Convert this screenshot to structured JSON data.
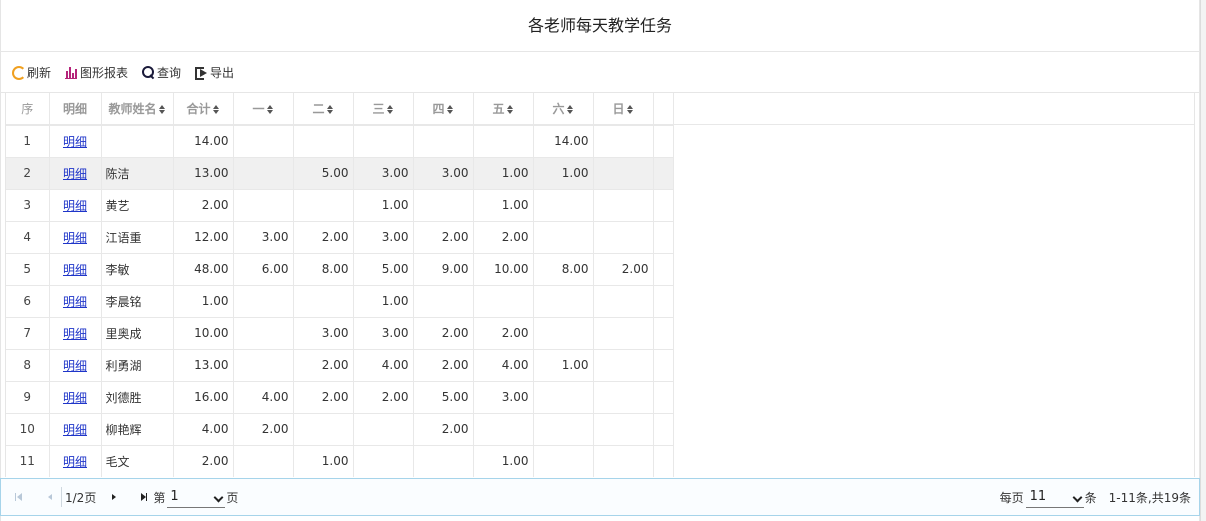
{
  "title": "各老师每天教学任务",
  "toolbar": {
    "refresh": "刷新",
    "chart_report": "图形报表",
    "query": "查询",
    "export": "导出"
  },
  "grid": {
    "headers": {
      "seq": "序",
      "detail": "明细",
      "name": "教师姓名",
      "total": "合计",
      "mon": "一",
      "tue": "二",
      "wed": "三",
      "thu": "四",
      "fri": "五",
      "sat": "六",
      "sun": "日"
    },
    "rows": [
      {
        "seq": "1",
        "detail": "明细",
        "name": "",
        "total": "14.00",
        "mon": "",
        "tue": "",
        "wed": "",
        "thu": "",
        "fri": "",
        "sat": "14.00",
        "sun": ""
      },
      {
        "seq": "2",
        "detail": "明细",
        "name": "陈洁",
        "total": "13.00",
        "mon": "",
        "tue": "5.00",
        "wed": "3.00",
        "thu": "3.00",
        "fri": "1.00",
        "sat": "1.00",
        "sun": ""
      },
      {
        "seq": "3",
        "detail": "明细",
        "name": "黄艺",
        "total": "2.00",
        "mon": "",
        "tue": "",
        "wed": "1.00",
        "thu": "",
        "fri": "1.00",
        "sat": "",
        "sun": ""
      },
      {
        "seq": "4",
        "detail": "明细",
        "name": "江语重",
        "total": "12.00",
        "mon": "3.00",
        "tue": "2.00",
        "wed": "3.00",
        "thu": "2.00",
        "fri": "2.00",
        "sat": "",
        "sun": ""
      },
      {
        "seq": "5",
        "detail": "明细",
        "name": "李敏",
        "total": "48.00",
        "mon": "6.00",
        "tue": "8.00",
        "wed": "5.00",
        "thu": "9.00",
        "fri": "10.00",
        "sat": "8.00",
        "sun": "2.00"
      },
      {
        "seq": "6",
        "detail": "明细",
        "name": "李晨铭",
        "total": "1.00",
        "mon": "",
        "tue": "",
        "wed": "1.00",
        "thu": "",
        "fri": "",
        "sat": "",
        "sun": ""
      },
      {
        "seq": "7",
        "detail": "明细",
        "name": "里奥成",
        "total": "10.00",
        "mon": "",
        "tue": "3.00",
        "wed": "3.00",
        "thu": "2.00",
        "fri": "2.00",
        "sat": "",
        "sun": ""
      },
      {
        "seq": "8",
        "detail": "明细",
        "name": "利勇湖",
        "total": "13.00",
        "mon": "",
        "tue": "2.00",
        "wed": "4.00",
        "thu": "2.00",
        "fri": "4.00",
        "sat": "1.00",
        "sun": ""
      },
      {
        "seq": "9",
        "detail": "明细",
        "name": "刘德胜",
        "total": "16.00",
        "mon": "4.00",
        "tue": "2.00",
        "wed": "2.00",
        "thu": "5.00",
        "fri": "3.00",
        "sat": "",
        "sun": ""
      },
      {
        "seq": "10",
        "detail": "明细",
        "name": "柳艳辉",
        "total": "4.00",
        "mon": "2.00",
        "tue": "",
        "wed": "",
        "thu": "2.00",
        "fri": "",
        "sat": "",
        "sun": ""
      },
      {
        "seq": "11",
        "detail": "明细",
        "name": "毛文",
        "total": "2.00",
        "mon": "",
        "tue": "1.00",
        "wed": "",
        "thu": "",
        "fri": "1.00",
        "sat": "",
        "sun": ""
      }
    ],
    "highlighted_row": 2
  },
  "pager": {
    "page_of": "1/2页",
    "page_prefix": "第",
    "page_value": "1",
    "page_suffix": "页",
    "per_page_label": "每页",
    "per_page_value": "11",
    "per_page_suffix": "条",
    "summary": "1-11条,共19条"
  },
  "icons": {
    "refresh": "refresh-icon",
    "chart": "bar-chart-icon",
    "query": "search-icon",
    "export": "export-icon"
  }
}
